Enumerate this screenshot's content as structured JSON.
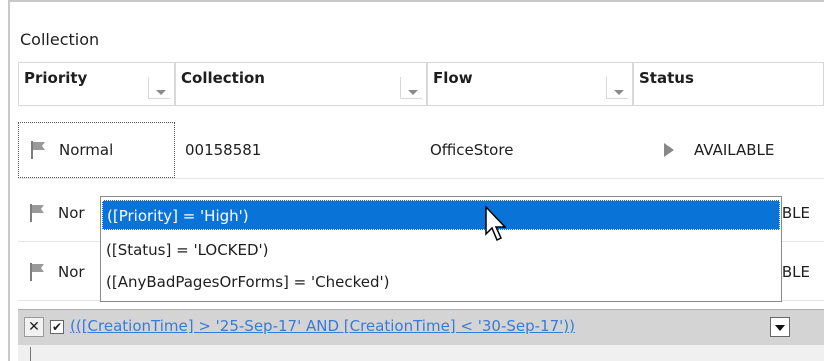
{
  "panel": {
    "title": "Collection"
  },
  "columns": [
    {
      "label": "Priority"
    },
    {
      "label": "Collection"
    },
    {
      "label": "Flow"
    },
    {
      "label": "Status"
    }
  ],
  "rows": [
    {
      "priority": "Normal",
      "collection": "00158581",
      "flow": "OfficeStore",
      "status": "AVAILABLE"
    },
    {
      "priority": "Nor",
      "collection": "",
      "flow": "",
      "status": "BLE"
    },
    {
      "priority": "Nor",
      "collection": "",
      "flow": "",
      "status": "BLE"
    }
  ],
  "popup": {
    "items": [
      "([Priority] = 'High')",
      "([Status] = 'LOCKED')",
      "([AnyBadPagesOrForms] = 'Checked')"
    ]
  },
  "filter_bar": {
    "close_symbol": "✕",
    "check_symbol": "✔",
    "expression": "(([CreationTime] > '25-Sep-17' AND [CreationTime] < '30-Sep-17'))"
  }
}
